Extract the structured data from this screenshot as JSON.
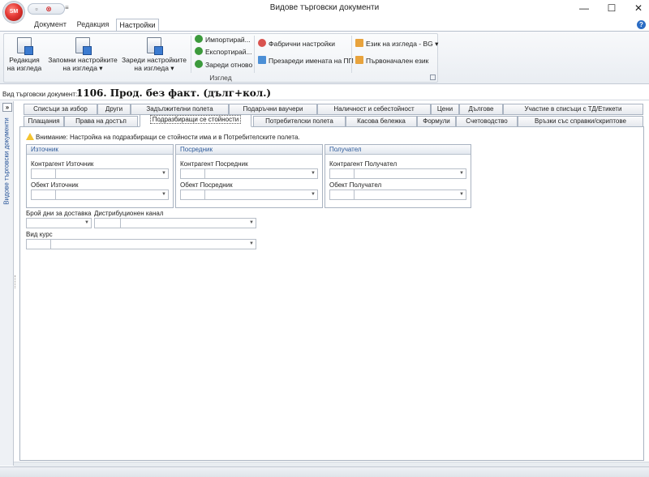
{
  "window": {
    "title": "Видове търговски документи",
    "app_logo_text": "SM",
    "minimize_icon": "minimize-icon",
    "maximize_icon": "maximize-icon",
    "close_icon": "close-icon"
  },
  "quick_access": {
    "save_icon": "save-icon",
    "cancel_icon": "cancel-icon",
    "customize_icon": "customize-icon"
  },
  "ribbon_tabs": [
    "Документ",
    "Редакция",
    "Настройки"
  ],
  "ribbon_active_tab": "Настройки",
  "ribbon": {
    "group_label": "Изглед",
    "large_buttons": [
      {
        "label1": "Редакция",
        "label2": "на изгледа"
      },
      {
        "label1": "Запомни настройките",
        "label2": "на изгледа ▾"
      },
      {
        "label1": "Зареди настройките",
        "label2": "на изгледа ▾"
      }
    ],
    "small_col1": [
      "Импортирай...",
      "Експортирай...",
      "Зареди отново"
    ],
    "small_col2": [
      "Фабрични настройки",
      "Презареди имената на ПП"
    ],
    "small_col3": [
      "Език на изгледа - BG ▾",
      "Първоначален език"
    ]
  },
  "document": {
    "label": "Вид търговски документ:",
    "value": "1106. Прод. без факт. (дълг+кол.)"
  },
  "side_panel": {
    "toggle": "»",
    "title": "Видове търговски документи"
  },
  "tabs_row1": [
    "Списъци за избор",
    "Други",
    "Задължителни полета",
    "Подаръчни ваучери",
    "Наличност и себестойност",
    "Цени",
    "Дългове",
    "Участие в списъци с ТД/Етикети"
  ],
  "tabs_row2": [
    "Плащания",
    "Права на достъп",
    "Подразбиращи се стойности",
    "Потребителски полета",
    "Касова бележка",
    "Формули",
    "Счетоводство",
    "Връзки със справки/скриптове"
  ],
  "active_tab": "Подразбиращи се стойности",
  "warning": "Внимание: Настройка на подразбиращи се стойности има и в Потребителските полета.",
  "panels": [
    {
      "title": "Източник",
      "field1": "Контрагент Източник",
      "field2": "Обект Източник"
    },
    {
      "title": "Посредник",
      "field1": "Контрагент Посредник",
      "field2": "Обект Посредник"
    },
    {
      "title": "Получател",
      "field1": "Контрагент Получател",
      "field2": "Обект Получател"
    }
  ],
  "delivery_days_label": "Брой дни за доставка",
  "distribution_channel_label": "Дистрибуционен канал",
  "course_type_label": "Вид курс",
  "help_icon": "help-icon"
}
